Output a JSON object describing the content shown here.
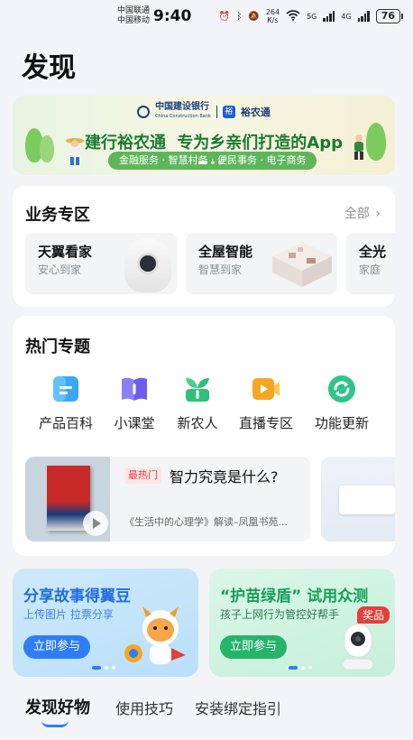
{
  "status_bar": {
    "carrier_1": "中国联通",
    "carrier_2": "中国移动",
    "time": "9:40",
    "speed_value": "264",
    "speed_unit": "K/s",
    "network_1": "5G",
    "network_2": "4G",
    "battery": "76"
  },
  "page": {
    "title": "发现"
  },
  "banner": {
    "bank_name": "中国建设银行",
    "bank_name_en": "China Construction Bank",
    "app_name": "裕农通",
    "headline_brand": "建行裕农通",
    "headline_rest": "专为乡亲们打造的App",
    "tags": "金融服务 · 智慧村务 · 便民事务 · 电子商务"
  },
  "business": {
    "title": "业务专区",
    "more_label": "全部",
    "items": [
      {
        "title": "天翼看家",
        "subtitle": "安心到家"
      },
      {
        "title": "全屋智能",
        "subtitle": "智慧到家"
      },
      {
        "title": "全光",
        "subtitle": "家庭"
      }
    ]
  },
  "topics": {
    "title": "热门专题",
    "items": [
      {
        "label": "产品百科",
        "icon": "document-icon",
        "color": "#3ba8f5"
      },
      {
        "label": "小课堂",
        "icon": "book-icon",
        "color": "#6a5cf0"
      },
      {
        "label": "新农人",
        "icon": "sprout-icon",
        "color": "#2fbf7a"
      },
      {
        "label": "直播专区",
        "icon": "video-icon",
        "color": "#f5a623"
      },
      {
        "label": "功能更新",
        "icon": "refresh-icon",
        "color": "#2fc48a"
      }
    ],
    "article": {
      "badge": "最热门",
      "title": "智力究竟是什么?",
      "subtitle": "《生活中的心理学》解读–凤凰书苑..."
    }
  },
  "promos": [
    {
      "title": "分享故事得翼豆",
      "subtitle": "上传图片 拉票分享",
      "button": "立即参与",
      "title_color": "#1f6fe0",
      "button_color": "#2f7df6"
    },
    {
      "title": "“护苗绿盾” 试用众测",
      "subtitle": "孩子上网行为管控好帮手",
      "button": "立即参与",
      "prize": "奖品",
      "title_color": "#17a05a",
      "button_color": "#25b46a"
    }
  ],
  "tabs": [
    {
      "label": "发现好物",
      "active": true
    },
    {
      "label": "使用技巧",
      "active": false
    },
    {
      "label": "安装绑定指引",
      "active": false
    }
  ]
}
